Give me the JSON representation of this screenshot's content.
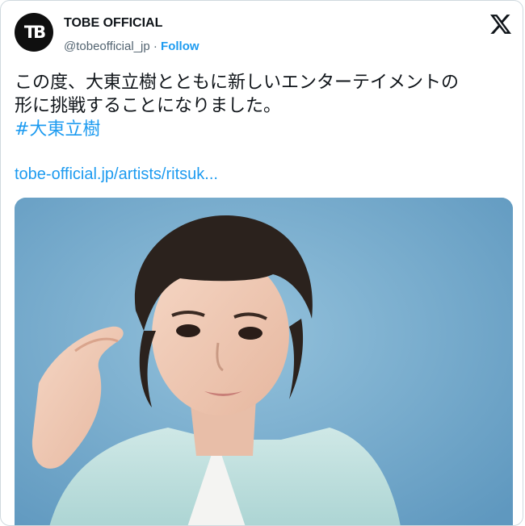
{
  "account": {
    "avatar_text": "TB",
    "display_name": "TOBE OFFICIAL",
    "handle": "@tobeofficial_jp",
    "separator": "·",
    "follow_label": "Follow"
  },
  "tweet": {
    "line1": "この度、大東立樹とともに新しいエンターテイメントの",
    "line2": "形に挑戦することになりました。",
    "hashtag": "#大東立樹",
    "link": "tobe-official.jp/artists/ritsuk..."
  },
  "colors": {
    "accent": "#1d9bf0",
    "text": "#0f1419",
    "secondary": "#536471",
    "photo_background": "#7db0cf"
  },
  "icons": {
    "platform": "x-logo-icon"
  }
}
